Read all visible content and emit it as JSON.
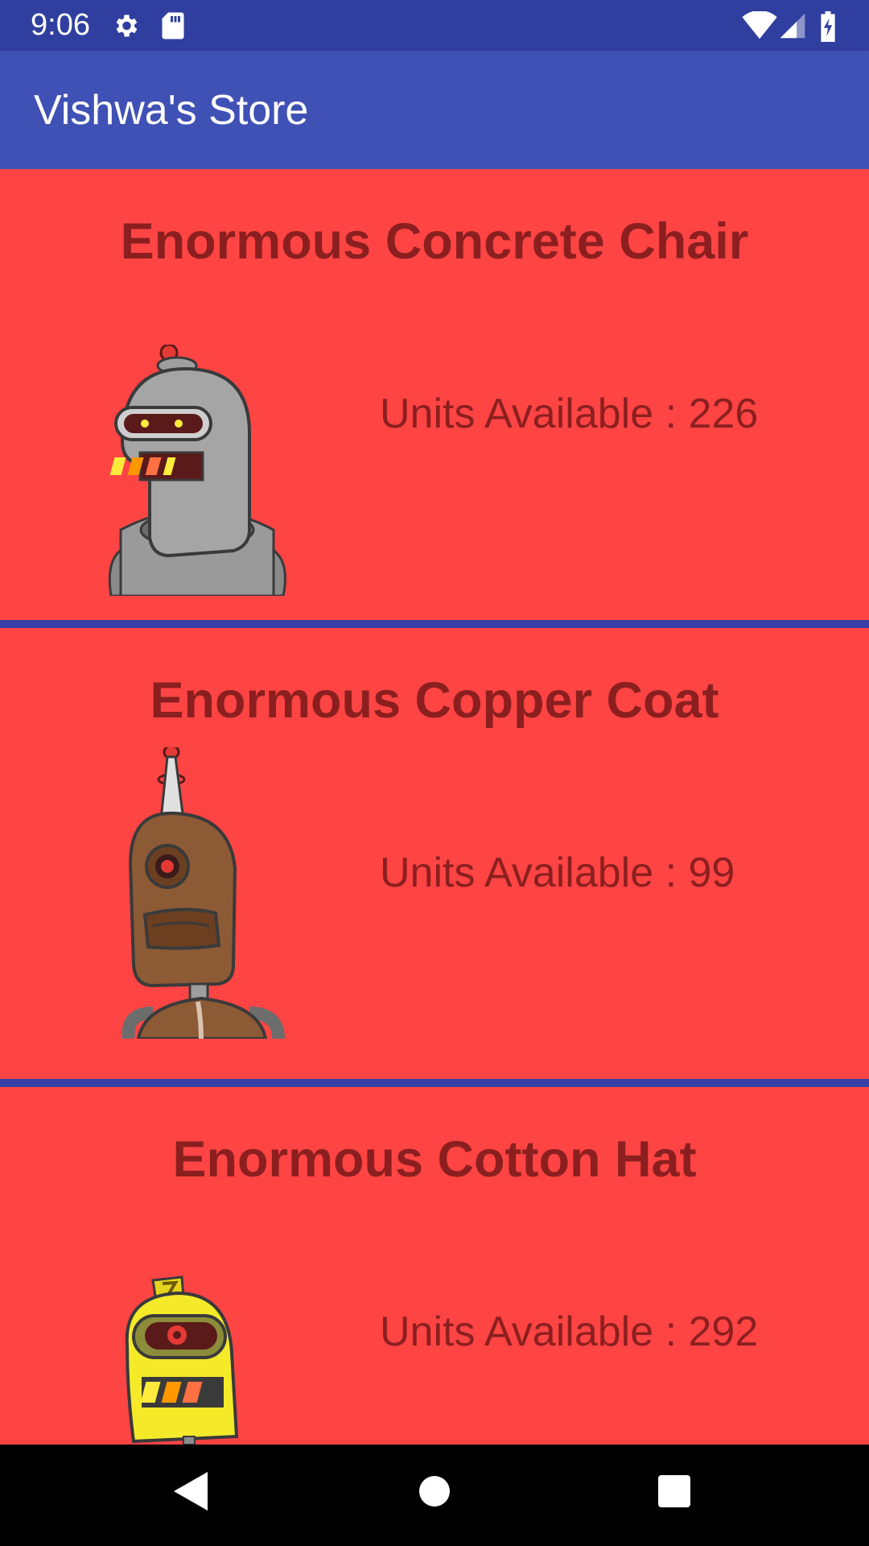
{
  "status_bar": {
    "time": "9:06",
    "left_icons": [
      "settings-gear-icon",
      "sd-card-icon"
    ],
    "right_icons": [
      "wifi-icon",
      "cell-signal-icon",
      "battery-charging-icon"
    ]
  },
  "app_bar": {
    "title": "Vishwa's Store",
    "color": "#3f51b5"
  },
  "products": [
    {
      "name": "Enormous Concrete Chair",
      "units_label": "Units Available : 226",
      "image": "gray-robot-icon"
    },
    {
      "name": "Enormous Copper Coat",
      "units_label": "Units Available : 99",
      "image": "brown-robot-icon"
    },
    {
      "name": "Enormous Cotton Hat",
      "units_label": "Units Available : 292",
      "image": "yellow-robot-icon"
    }
  ],
  "colors": {
    "card_background": "#ff4444",
    "card_text": "#8b1f1f",
    "divider": "#3840a8"
  },
  "nav_bar": {
    "buttons": [
      "back-icon",
      "home-icon",
      "recents-icon"
    ]
  }
}
